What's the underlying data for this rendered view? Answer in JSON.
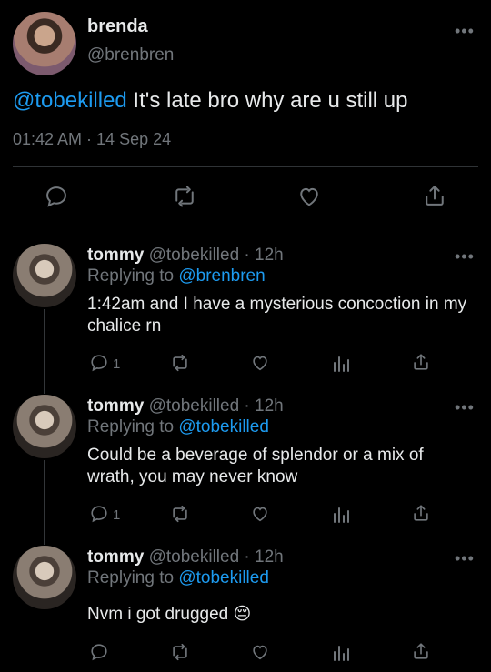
{
  "main_tweet": {
    "display_name": "brenda",
    "handle": "@brenbren",
    "mention": "@tobekilled",
    "text": " It's late bro why are u still up",
    "timestamp": "01:42 AM · 14 Sep 24"
  },
  "replies": [
    {
      "display_name": "tommy",
      "handle_time": "@tobekilled · 12h",
      "replying_prefix": "Replying to",
      "replying_to": "@brenbren",
      "text": "1:42am and I have a mysterious concoction in my chalice rn",
      "reply_count": "1"
    },
    {
      "display_name": "tommy",
      "handle_time": "@tobekilled · 12h",
      "replying_prefix": "Replying to",
      "replying_to": "@tobekilled",
      "text": "Could be a beverage of splendor or a mix of wrath, you may never know",
      "reply_count": "1"
    },
    {
      "display_name": "tommy",
      "handle_time": "@tobekilled · 12h",
      "replying_prefix": "Replying to",
      "replying_to": "@tobekilled",
      "text": "Nvm i got drugged 😔",
      "reply_count": ""
    }
  ],
  "icons": {
    "more": "more-horizontal-icon",
    "reply": "reply-bubble-icon",
    "retweet": "retweet-icon",
    "like": "heart-icon",
    "analytics": "analytics-bars-icon",
    "share": "share-icon"
  },
  "colors": {
    "background": "#000000",
    "accent": "#1d9bf0",
    "muted": "#71767b",
    "divider": "#2f3336"
  }
}
